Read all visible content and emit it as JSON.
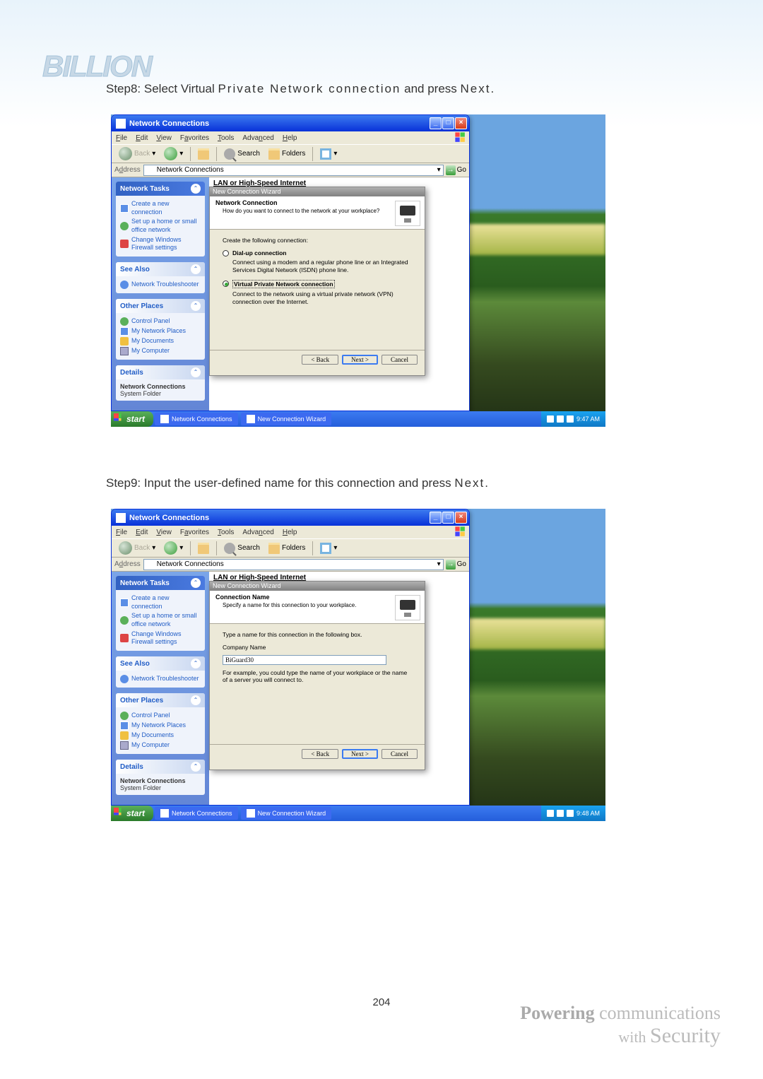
{
  "step8": {
    "prefix": "Step8: Select Virtual ",
    "spaced": "Private Network connection",
    "suffix": " and press ",
    "next": "Next",
    "period": "."
  },
  "step9": {
    "text": "Step9: Input the user-defined name for this connection and press ",
    "next": "Next",
    "period": "."
  },
  "window": {
    "title": "Network Connections",
    "menu": {
      "file": "File",
      "edit": "Edit",
      "view": "View",
      "favorites": "Favorites",
      "tools": "Tools",
      "advanced": "Advanced",
      "help": "Help"
    },
    "toolbar": {
      "back": "Back",
      "search": "Search",
      "folders": "Folders"
    },
    "address_label": "Address",
    "address_value": "Network Connections",
    "go": "Go"
  },
  "sidepanel": {
    "tasks": {
      "title": "Network Tasks",
      "items": [
        "Create a new connection",
        "Set up a home or small office network",
        "Change Windows Firewall settings"
      ]
    },
    "seealso": {
      "title": "See Also",
      "items": [
        "Network Troubleshooter"
      ]
    },
    "other": {
      "title": "Other Places",
      "items": [
        "Control Panel",
        "My Network Places",
        "My Documents",
        "My Computer"
      ]
    },
    "details": {
      "title": "Details",
      "name": "Network Connections",
      "type": "System Folder"
    }
  },
  "category": "LAN or High-Speed Internet",
  "wizard_header": "New Connection Wizard",
  "wizard8": {
    "title": "Network Connection",
    "subtitle": "How do you want to connect to the network at your workplace?",
    "intro": "Create the following connection:",
    "opt1_label": "Dial-up connection",
    "opt1_desc": "Connect using a modem and a regular phone line or an Integrated Services Digital Network (ISDN) phone line.",
    "opt2_label": "Virtual Private Network connection",
    "opt2_desc": "Connect to the network using a virtual private network (VPN) connection over the Internet."
  },
  "wizard9": {
    "title": "Connection Name",
    "subtitle": "Specify a name for this connection to your workplace.",
    "intro": "Type a name for this connection in the following box.",
    "field_label": "Company Name",
    "field_value": "BiGuard30",
    "hint": "For example, you could type the name of your workplace or the name of a server you will connect to."
  },
  "wizard_buttons": {
    "back": "< Back",
    "next": "Next >",
    "cancel": "Cancel"
  },
  "taskbar": {
    "start": "start",
    "items": [
      "Network Connections",
      "New Connection Wizard"
    ],
    "time8": "9:47 AM",
    "time9": "9:48 AM"
  },
  "page_number": "204",
  "footer": {
    "line1a": "Powering",
    "line1b": " communications",
    "line2a": "with ",
    "line2b": "Security"
  }
}
